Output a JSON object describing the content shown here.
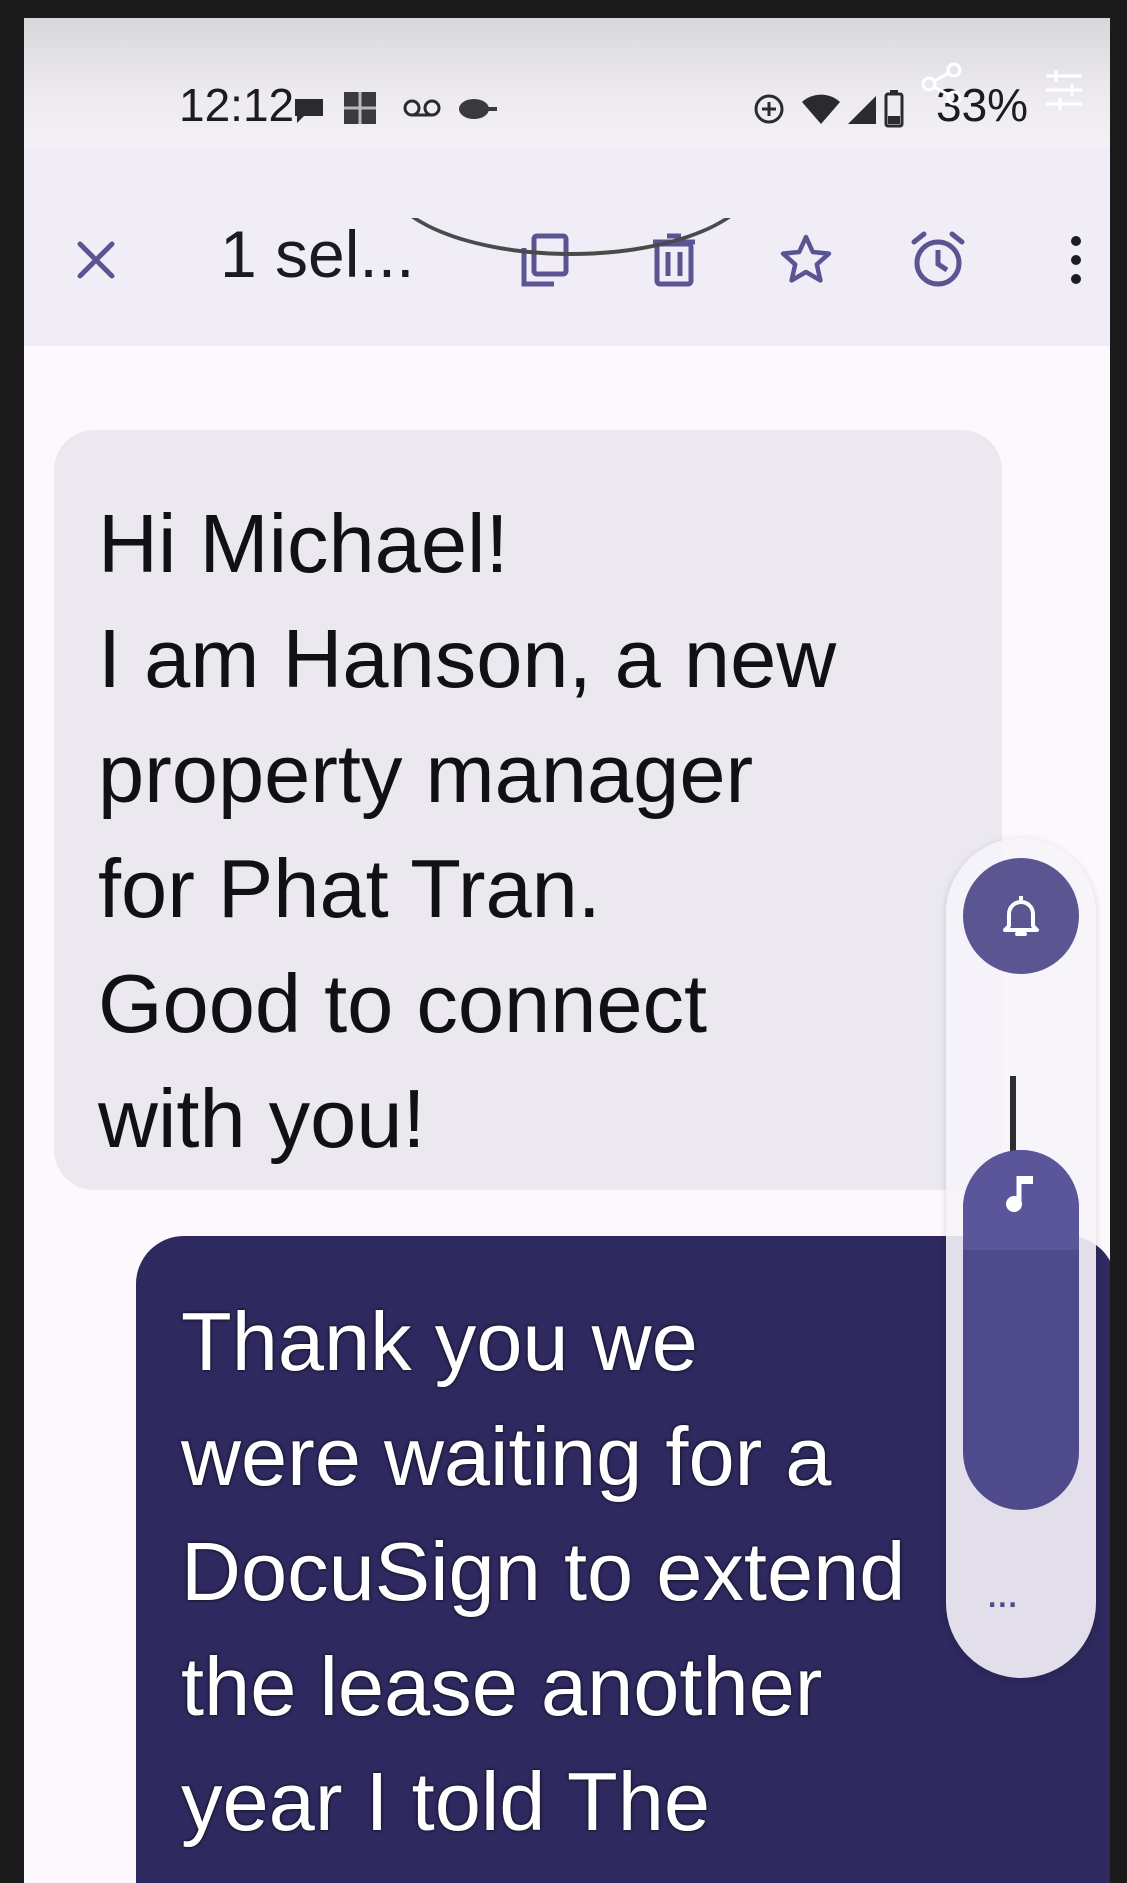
{
  "status_bar": {
    "time": "12:12",
    "battery_percent": "33%",
    "icons": [
      "chat-bubble-icon",
      "photo-icon",
      "voicemail-icon",
      "app-notification-icon",
      "data-saver-icon",
      "wifi-icon",
      "cell-signal-icon",
      "battery-icon",
      "share-icon",
      "settings-sliders-icon"
    ]
  },
  "action_bar": {
    "selection_label": "1 sel...",
    "actions": [
      "close-icon",
      "copy-icon",
      "delete-icon",
      "star-icon",
      "snooze-icon",
      "more-vert-icon"
    ]
  },
  "messages": [
    {
      "direction": "incoming",
      "text": "Hi Michael!\nI am Hanson, a new\nproperty manager\nfor Phat Tran.\nGood to connect\nwith you!"
    },
    {
      "direction": "outgoing",
      "text": "Thank you we\nwere waiting for a\nDocuSign to extend\nthe lease another\nyear I told The"
    }
  ],
  "volume_panel": {
    "more_label": "...",
    "icons": [
      "bell-icon",
      "music-note-icon"
    ]
  },
  "colors": {
    "accent": "#5b5592",
    "outgoing_bubble": "#2e295e",
    "incoming_bubble": "#ebe8f0",
    "action_bar": "#f0edf6"
  }
}
